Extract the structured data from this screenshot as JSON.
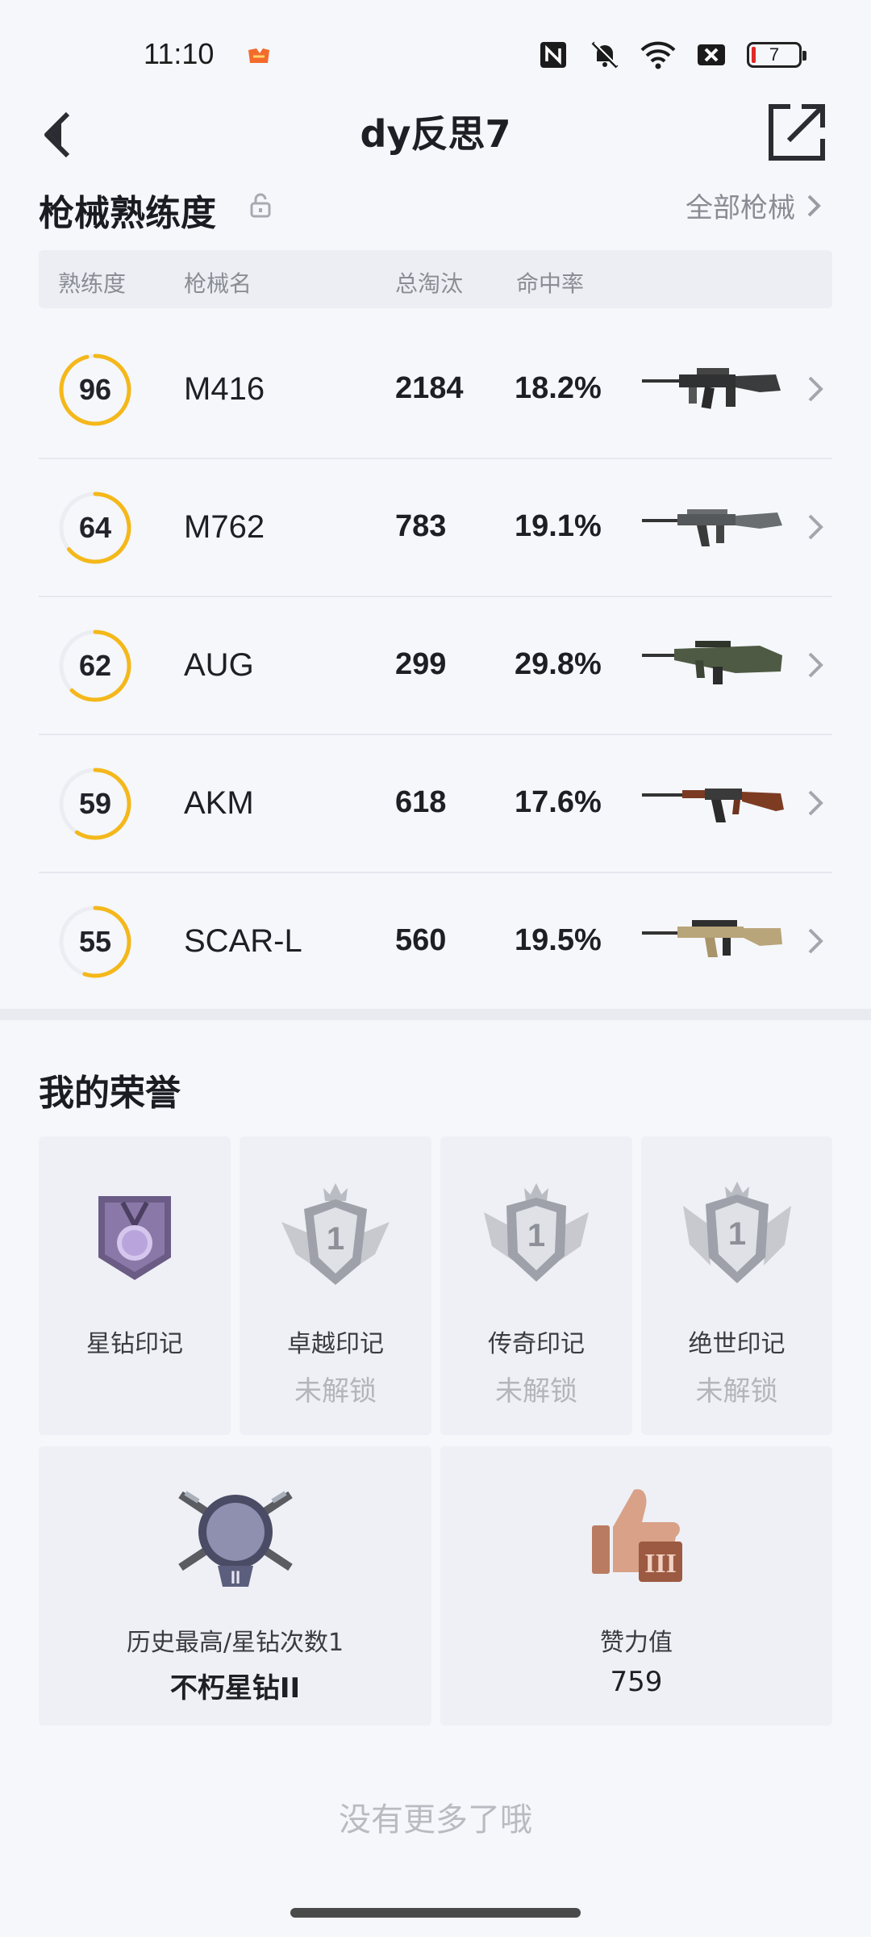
{
  "status_bar": {
    "time": "11:10",
    "battery": "7"
  },
  "header": {
    "title": "dy反思7"
  },
  "weapons": {
    "title": "枪械熟练度",
    "all_link": "全部枪械",
    "columns": [
      "熟练度",
      "枪械名",
      "总淘汰",
      "命中率"
    ],
    "rows": [
      {
        "proficiency": "96",
        "proficiency_fraction": 0.96,
        "name": "M416",
        "kills": "2184",
        "accuracy": "18.2%"
      },
      {
        "proficiency": "64",
        "proficiency_fraction": 0.64,
        "name": "M762",
        "kills": "783",
        "accuracy": "19.1%"
      },
      {
        "proficiency": "62",
        "proficiency_fraction": 0.62,
        "name": "AUG",
        "kills": "299",
        "accuracy": "29.8%"
      },
      {
        "proficiency": "59",
        "proficiency_fraction": 0.59,
        "name": "AKM",
        "kills": "618",
        "accuracy": "17.6%"
      },
      {
        "proficiency": "55",
        "proficiency_fraction": 0.55,
        "name": "SCAR-L",
        "kills": "560",
        "accuracy": "19.5%"
      }
    ]
  },
  "honors": {
    "title": "我的荣誉",
    "badges": [
      {
        "label": "星钻印记",
        "status": ""
      },
      {
        "label": "卓越印记",
        "status": "未解锁"
      },
      {
        "label": "传奇印记",
        "status": "未解锁"
      },
      {
        "label": "绝世印记",
        "status": "未解锁"
      }
    ],
    "rank": {
      "label": "历史最高/星钻次数1",
      "value": "不朽星钻II"
    },
    "likes": {
      "label": "赞力值",
      "value": "759"
    }
  },
  "footer": {
    "no_more": "没有更多了哦"
  },
  "colors": {
    "ring": "#f4b81a",
    "ring_track": "#ebedf2"
  }
}
